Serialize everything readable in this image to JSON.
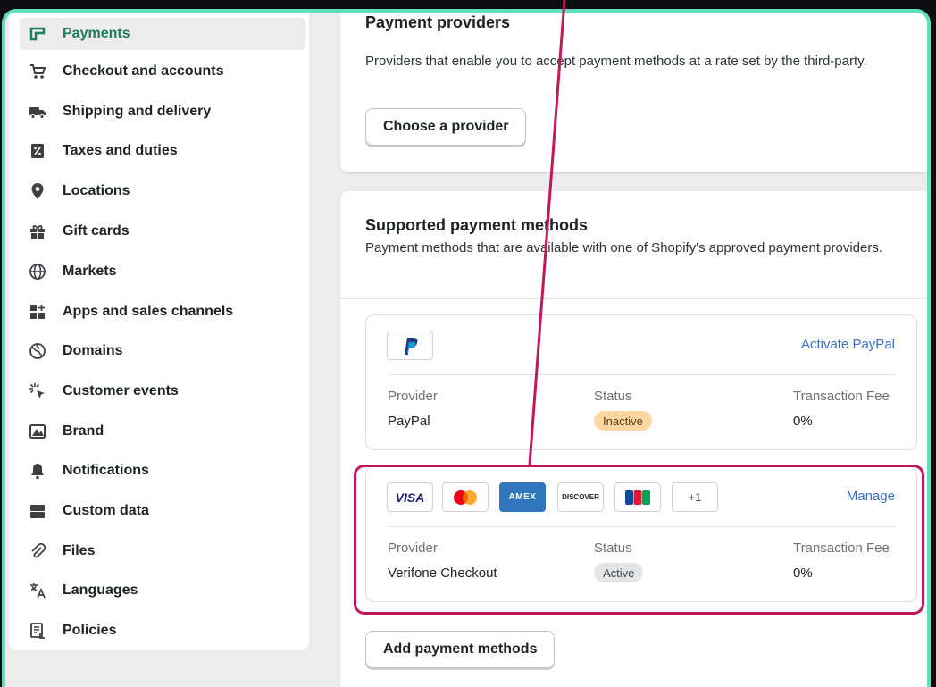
{
  "sidebar": {
    "items": [
      {
        "label": "Payments",
        "icon": "payments-icon",
        "active": true
      },
      {
        "label": "Checkout and accounts",
        "icon": "cart-icon"
      },
      {
        "label": "Shipping and delivery",
        "icon": "truck-icon"
      },
      {
        "label": "Taxes and duties",
        "icon": "tax-icon"
      },
      {
        "label": "Locations",
        "icon": "location-pin-icon"
      },
      {
        "label": "Gift cards",
        "icon": "gift-icon"
      },
      {
        "label": "Markets",
        "icon": "globe-icon"
      },
      {
        "label": "Apps and sales channels",
        "icon": "apps-icon"
      },
      {
        "label": "Domains",
        "icon": "domains-globe-icon"
      },
      {
        "label": "Customer events",
        "icon": "cursor-click-icon"
      },
      {
        "label": "Brand",
        "icon": "brand-icon"
      },
      {
        "label": "Notifications",
        "icon": "bell-icon"
      },
      {
        "label": "Custom data",
        "icon": "custom-data-icon"
      },
      {
        "label": "Files",
        "icon": "paperclip-icon"
      },
      {
        "label": "Languages",
        "icon": "translate-icon"
      },
      {
        "label": "Policies",
        "icon": "policies-icon"
      }
    ]
  },
  "payment_providers": {
    "title": "Payment providers",
    "description": "Providers that enable you to accept payment methods at a rate set by the third-party.",
    "button": "Choose a provider"
  },
  "supported_methods": {
    "title": "Supported payment methods",
    "description": "Payment methods that are available with one of Shopify's approved payment providers.",
    "paypal": {
      "action": "Activate PayPal",
      "provider_label": "Provider",
      "provider": "PayPal",
      "status_label": "Status",
      "status": "Inactive",
      "fee_label": "Transaction Fee",
      "fee": "0%"
    },
    "verifone": {
      "logos": [
        "VISA",
        "Mastercard",
        "AMEX",
        "DISCOVER",
        "JCB"
      ],
      "more": "+1",
      "action": "Manage",
      "provider_label": "Provider",
      "provider": "Verifone Checkout",
      "status_label": "Status",
      "status": "Active",
      "fee_label": "Transaction Fee",
      "fee": "0%"
    },
    "add_button": "Add payment methods"
  },
  "colors": {
    "frame_border": "#5ee0be",
    "highlight": "#c2185b",
    "link": "#3b6fc4",
    "active_nav_text": "#1e7b5e"
  }
}
